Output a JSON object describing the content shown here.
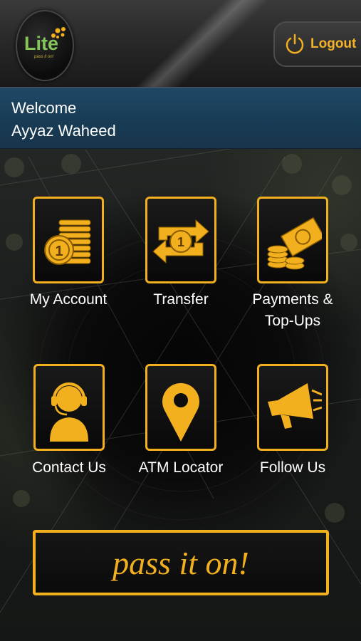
{
  "header": {
    "brand": "Lite",
    "brand_tagline": "pass it on!",
    "logout_label": "Logout"
  },
  "welcome": {
    "greeting": "Welcome",
    "user_name": "Ayyaz Waheed"
  },
  "menu": [
    {
      "label": "My Account",
      "icon": "coins-stack-icon"
    },
    {
      "label": "Transfer",
      "icon": "transfer-arrows-icon"
    },
    {
      "label": "Payments &",
      "label2": "Top-Ups",
      "icon": "payments-icon"
    },
    {
      "label": "Contact Us",
      "icon": "headset-agent-icon"
    },
    {
      "label": "ATM Locator",
      "icon": "location-pin-icon"
    },
    {
      "label": "Follow Us",
      "icon": "megaphone-icon"
    }
  ],
  "banner": {
    "text": "pass it on!"
  },
  "colors": {
    "accent": "#f2b01e",
    "brand_green": "#86c55a",
    "welcome_bar": "#1f4865"
  }
}
